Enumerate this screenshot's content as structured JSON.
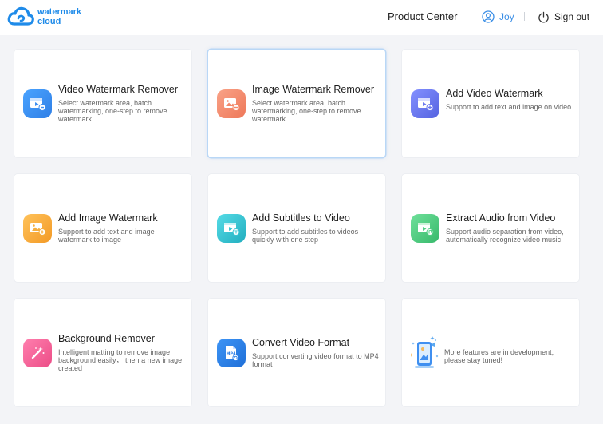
{
  "header": {
    "logo_line1": "watermark",
    "logo_line2": "cloud",
    "product_center": "Product Center",
    "user_name": "Joy",
    "sign_out": "Sign out"
  },
  "colors": {
    "brand": "#1f8be9",
    "user_link": "#3a8ee6"
  },
  "cards": [
    {
      "title": "Video Watermark Remover",
      "description": "Select watermark area, batch watermarking, one-step to remove watermark",
      "icon": "video-remove-icon",
      "color": "#3f8ff0"
    },
    {
      "title": "Image Watermark Remover",
      "description": "Select watermark area, batch watermarking, one-step to remove watermark",
      "icon": "image-remove-icon",
      "color": "#f38a6c"
    },
    {
      "title": "Add Video Watermark",
      "description": "Support to add text and image on video",
      "icon": "video-add-icon",
      "color": "#6b78ee"
    },
    {
      "title": "Add Image Watermark",
      "description": "Support to add text and image watermark to image",
      "icon": "image-add-icon",
      "color": "#f5ae3e"
    },
    {
      "title": "Add Subtitles to Video",
      "description": "Support to add subtitles to videos quickly with one step",
      "icon": "subtitle-icon",
      "color": "#39c6d4"
    },
    {
      "title": "Extract Audio from Video",
      "description": "Support audio separation from video, automatically recognize video music",
      "icon": "audio-extract-icon",
      "color": "#52cf86"
    },
    {
      "title": "Background Remover",
      "description": "Intelligent matting to remove image background easily， then a new image created",
      "icon": "magic-wand-icon",
      "color": "#f5659a"
    },
    {
      "title": "Convert Video Format",
      "description": "Support converting video format to MP4 format",
      "icon": "mp4-file-icon",
      "color": "#2c7fe8"
    }
  ],
  "coming_soon": {
    "description": "More features are in development, please stay tuned!",
    "icon": "phone-illustration-icon"
  },
  "mp4_label": "MP4"
}
